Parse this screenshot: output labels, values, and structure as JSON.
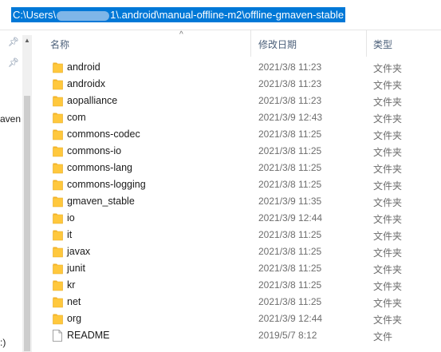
{
  "address": {
    "prefix": "C:\\Users\\",
    "suffix": "1\\.android\\manual-offline-m2\\offline-gmaven-stable"
  },
  "nav": {
    "labels": [
      "aven",
      ":)"
    ]
  },
  "columns": {
    "name": "名称",
    "date": "修改日期",
    "type": "类型"
  },
  "files": [
    {
      "name": "android",
      "date": "2021/3/8 11:23",
      "type": "文件夹",
      "icon": "folder-icon"
    },
    {
      "name": "androidx",
      "date": "2021/3/8 11:23",
      "type": "文件夹",
      "icon": "folder-icon"
    },
    {
      "name": "aopalliance",
      "date": "2021/3/8 11:23",
      "type": "文件夹",
      "icon": "folder-icon"
    },
    {
      "name": "com",
      "date": "2021/3/9 12:43",
      "type": "文件夹",
      "icon": "folder-icon"
    },
    {
      "name": "commons-codec",
      "date": "2021/3/8 11:25",
      "type": "文件夹",
      "icon": "folder-icon"
    },
    {
      "name": "commons-io",
      "date": "2021/3/8 11:25",
      "type": "文件夹",
      "icon": "folder-icon"
    },
    {
      "name": "commons-lang",
      "date": "2021/3/8 11:25",
      "type": "文件夹",
      "icon": "folder-icon"
    },
    {
      "name": "commons-logging",
      "date": "2021/3/8 11:25",
      "type": "文件夹",
      "icon": "folder-icon"
    },
    {
      "name": "gmaven_stable",
      "date": "2021/3/9 11:35",
      "type": "文件夹",
      "icon": "folder-icon"
    },
    {
      "name": "io",
      "date": "2021/3/9 12:44",
      "type": "文件夹",
      "icon": "folder-icon"
    },
    {
      "name": "it",
      "date": "2021/3/8 11:25",
      "type": "文件夹",
      "icon": "folder-icon"
    },
    {
      "name": "javax",
      "date": "2021/3/8 11:25",
      "type": "文件夹",
      "icon": "folder-icon"
    },
    {
      "name": "junit",
      "date": "2021/3/8 11:25",
      "type": "文件夹",
      "icon": "folder-icon"
    },
    {
      "name": "kr",
      "date": "2021/3/8 11:25",
      "type": "文件夹",
      "icon": "folder-icon"
    },
    {
      "name": "net",
      "date": "2021/3/8 11:25",
      "type": "文件夹",
      "icon": "folder-icon"
    },
    {
      "name": "org",
      "date": "2021/3/9 12:44",
      "type": "文件夹",
      "icon": "folder-icon"
    },
    {
      "name": "README",
      "date": "2019/5/7 8:12",
      "type": "文件",
      "icon": "file-icon"
    }
  ],
  "colors": {
    "selection": "#0078d7",
    "folder": "#ffc83d",
    "header_text": "#4c607a"
  }
}
